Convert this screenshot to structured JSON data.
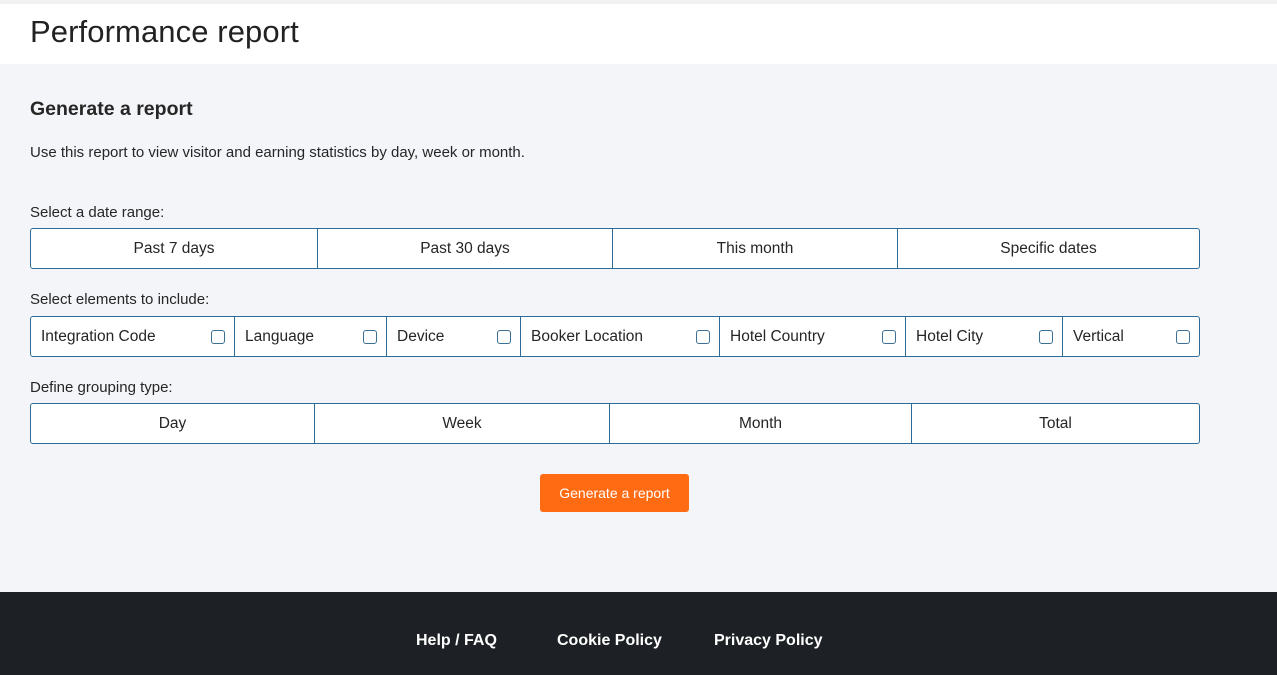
{
  "header": {
    "title": "Performance report"
  },
  "main": {
    "section_title": "Generate a report",
    "description": "Use this report to view visitor and earning statistics by day, week or month.",
    "date_range": {
      "label": "Select a date range:",
      "options": [
        "Past 7 days",
        "Past 30 days",
        "This month",
        "Specific dates"
      ]
    },
    "elements": {
      "label": "Select elements to include:",
      "items": [
        {
          "label": "Integration Code",
          "checked": false
        },
        {
          "label": "Language",
          "checked": false
        },
        {
          "label": "Device",
          "checked": false
        },
        {
          "label": "Booker Location",
          "checked": false
        },
        {
          "label": "Hotel Country",
          "checked": false
        },
        {
          "label": "Hotel City",
          "checked": false
        },
        {
          "label": "Vertical",
          "checked": false
        }
      ]
    },
    "grouping": {
      "label": "Define grouping type:",
      "options": [
        "Day",
        "Week",
        "Month",
        "Total"
      ]
    },
    "generate_button": "Generate a report"
  },
  "footer": {
    "links": [
      "Help / FAQ",
      "Cookie Policy",
      "Privacy Policy"
    ]
  },
  "colors": {
    "accent": "#ff6b13",
    "border": "#2d6c99",
    "footer_bg": "#1d2125",
    "page_bg": "#f4f5f9"
  }
}
